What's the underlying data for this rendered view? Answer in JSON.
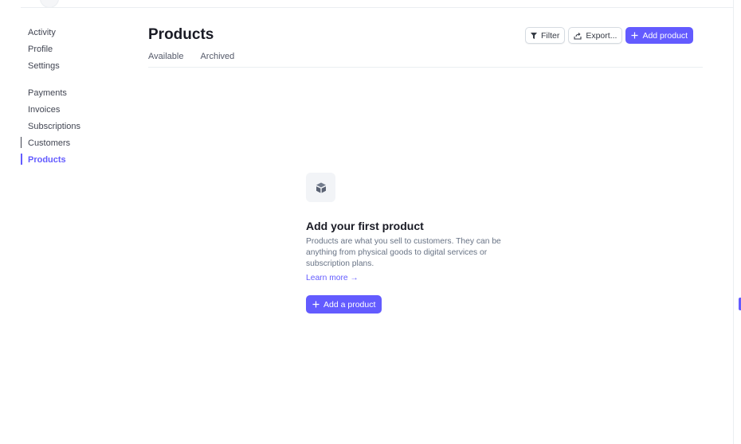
{
  "sidebar": {
    "groups": [
      {
        "items": [
          {
            "label": "Activity",
            "active": false
          },
          {
            "label": "Profile",
            "active": false
          },
          {
            "label": "Settings",
            "active": false
          }
        ]
      },
      {
        "items": [
          {
            "label": "Payments",
            "active": false
          },
          {
            "label": "Invoices",
            "active": false
          },
          {
            "label": "Subscriptions",
            "active": false
          },
          {
            "label": "Customers",
            "active": false
          },
          {
            "label": "Products",
            "active": true
          }
        ]
      }
    ]
  },
  "header": {
    "title": "Products",
    "filter_label": "Filter",
    "export_label": "Export...",
    "add_label": "Add product"
  },
  "tabs": [
    {
      "label": "Available"
    },
    {
      "label": "Archived"
    }
  ],
  "empty_state": {
    "icon": "box-icon",
    "title": "Add your first product",
    "description": "Products are what you sell to customers. They can be anything from physical goods to digital services or subscription plans.",
    "link_label": "Learn more →",
    "button_label": "Add a product"
  },
  "colors": {
    "accent": "#635bff",
    "text": "#30313d",
    "muted": "#687385"
  }
}
